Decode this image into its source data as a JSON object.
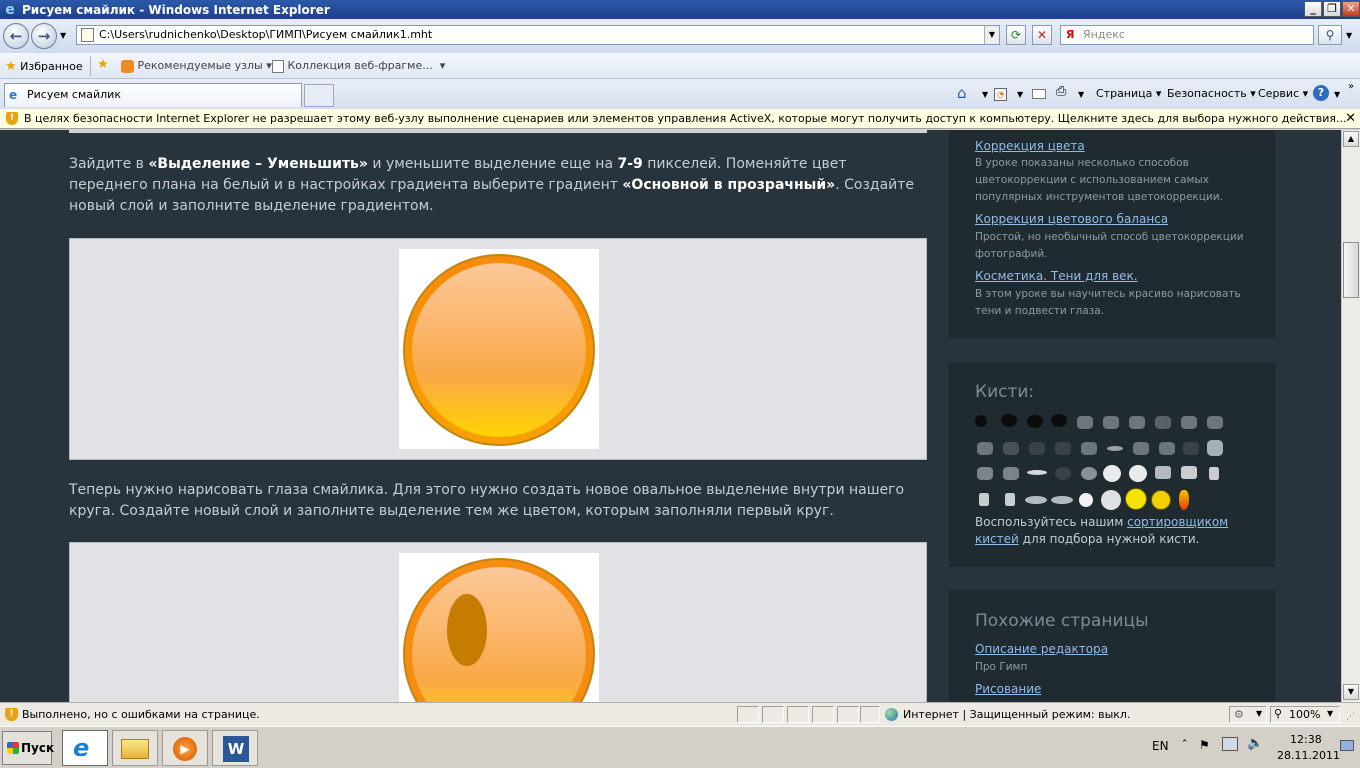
{
  "window": {
    "title": "Рисуем смайлик - Windows Internet Explorer"
  },
  "address_bar": {
    "url": "C:\\Users\\rudnichenko\\Desktop\\ГИМП\\Рисуем смайлик1.mht",
    "search_placeholder": "Яндекс",
    "search_provider_letter": "Я"
  },
  "favorites_bar": {
    "favorites_label": "Избранное",
    "items": [
      {
        "label": "Рекомендуемые узлы"
      },
      {
        "label": "Коллекция веб-фрагме..."
      }
    ]
  },
  "tabs": [
    {
      "label": "Рисуем смайлик"
    }
  ],
  "command_bar": {
    "page_label": "Страница",
    "safety_label": "Безопасность",
    "tools_label": "Сервис"
  },
  "infobar": {
    "message": "В целях безопасности Internet Explorer не разрешает этому веб-узлу выполнение сценариев или элементов управления ActiveX, которые могут получить доступ к компьютеру. Щелкните здесь для выбора нужного действия..."
  },
  "article": {
    "para1": {
      "t1": "Зайдите в ",
      "b1": "«Выделение – Уменьшить»",
      "t2": " и уменьшите выделение еще на ",
      "b2": "7-9",
      "t3": " пикселей. Поменяйте цвет переднего плана на белый и в настройках градиента выберите градиент ",
      "b3": "«Основной в прозрачный»",
      "t4": ". Создайте новый слой и заполните выделение градиентом."
    },
    "para2": "Теперь нужно нарисовать глаза смайлика. Для этого нужно создать новое овальное выделение внутри нашего круга. Создайте новый слой и заполните выделение тем же цветом, которым заполняли первый круг."
  },
  "sidebar": {
    "related_lessons": [
      {
        "title": "Коррекция цвета",
        "desc": "В уроке показаны несколько способов цветокоррекции с использованием самых популярных инструментов цветокоррекции."
      },
      {
        "title": "Коррекция цветового баланса",
        "desc": "Простой, но необычный способ цветокоррекции фотографий."
      },
      {
        "title": "Косметика. Тени для век.",
        "desc": "В этом уроке вы научитесь красиво нарисовать тени и подвести глаза."
      }
    ],
    "brushes": {
      "heading": "Кисти:",
      "text_before": "Воспользуйтесь нашим ",
      "link": "сортировщиком кистей",
      "text_after": " для подбора нужной кисти."
    },
    "similar_pages": {
      "heading": "Похожие страницы",
      "items": [
        {
          "title": "Описание редактора",
          "desc": "Про Гимп"
        },
        {
          "title": "Рисование",
          "desc": ""
        }
      ]
    }
  },
  "status_bar": {
    "status_text": "Выполнено, но с ошибками на странице.",
    "zone_text": "Интернет | Защищенный режим: выкл.",
    "zoom": "100%"
  },
  "taskbar": {
    "start_label": "Пуск",
    "language": "EN",
    "time": "12:38",
    "date": "28.11.2011"
  },
  "colors": {
    "page_bg": "#28343d",
    "sidebar_box": "#1f2a31",
    "link": "#8fbde8",
    "smiley_orange": "#f7a51c"
  }
}
